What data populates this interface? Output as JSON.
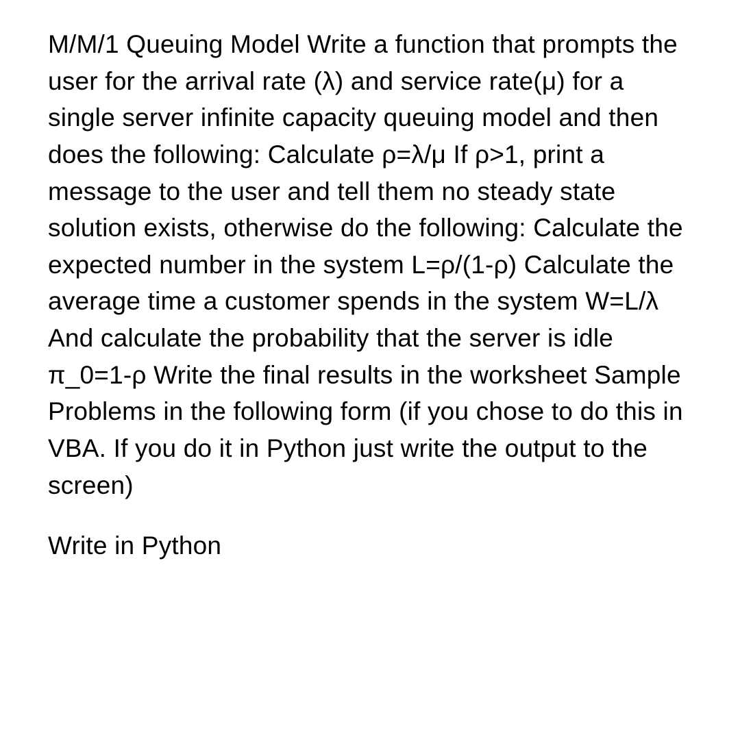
{
  "document": {
    "paragraph1": "M/M/1 Queuing Model Write a function that prompts the user for the arrival rate (λ) and service rate(μ) for a single server infinite capacity queuing model and then does the following: Calculate ρ=λ/μ If ρ>1, print a message to the user and tell them no steady state solution exists, otherwise do the following: Calculate the expected number in the system L=ρ/(1-ρ) Calculate the average time a customer spends in the system W=L/λ And calculate the probability that the server is idle π_0=1-ρ Write the final results in the worksheet Sample Problems in the following form (if you chose to do this in VBA. If you do it in Python just write the output to the screen)",
    "paragraph2": "Write in Python"
  }
}
